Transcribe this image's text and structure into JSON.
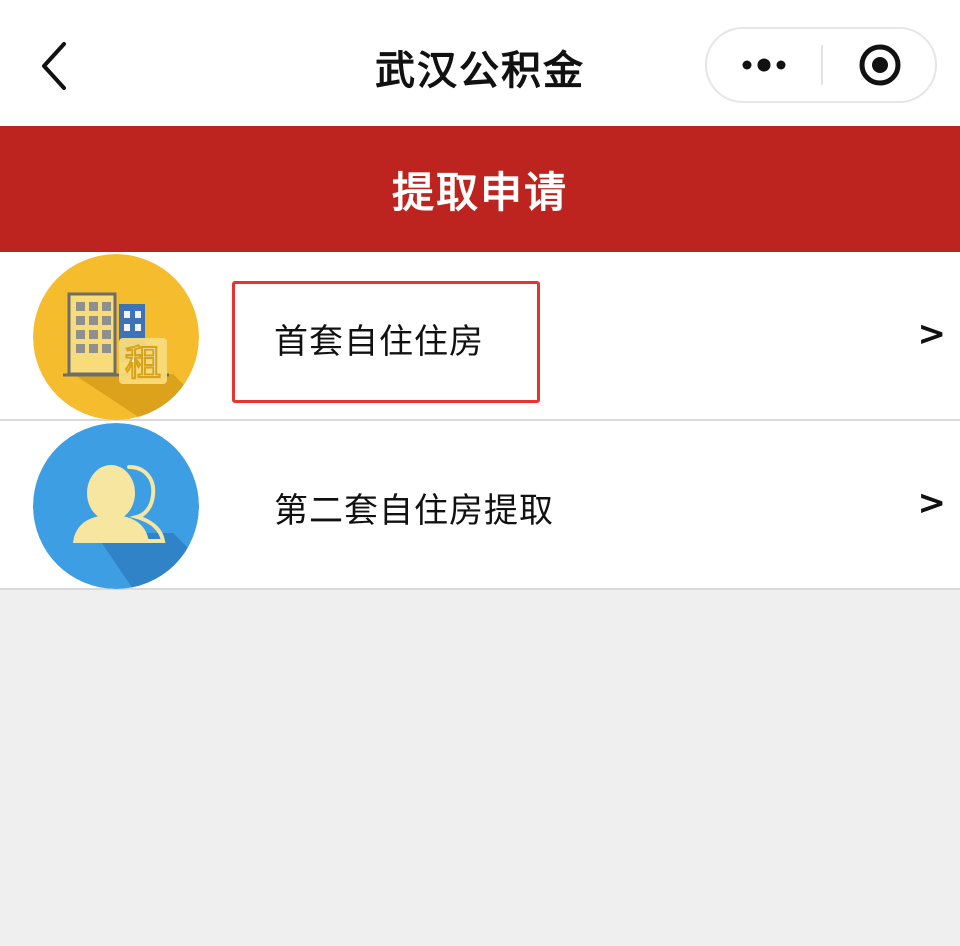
{
  "navbar": {
    "back_icon": "chevron-left-icon",
    "title": "武汉公积金",
    "more_icon": "more-dots-icon",
    "close_icon": "target-circle-icon"
  },
  "banner": {
    "title": "提取申请",
    "color": "#bd241f"
  },
  "list": {
    "items": [
      {
        "label": "首套自住住房",
        "arrow": ">",
        "icon": "building-rent-icon",
        "icon_badge_text": "租",
        "icon_color": "#f5bd2e",
        "highlighted": true
      },
      {
        "label": "第二套自住房提取",
        "arrow": ">",
        "icon": "users-icon",
        "icon_color": "#3e9ee3",
        "highlighted": false
      }
    ]
  },
  "colors": {
    "highlight_border": "#e8322e",
    "page_background": "#efefef"
  }
}
